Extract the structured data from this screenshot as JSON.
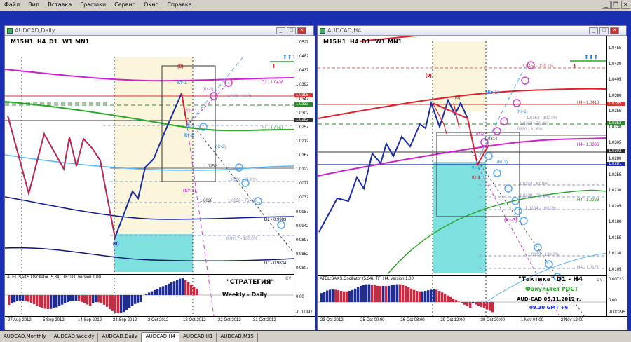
{
  "menu": [
    "Файл",
    "Вид",
    "Вставка",
    "Графики",
    "Сервис",
    "Окно",
    "Справка"
  ],
  "window_controls": [
    "_",
    "❐",
    "✕"
  ],
  "left_chart": {
    "title": "AUDCAD,Daily",
    "timeframes": [
      "M15",
      "H1",
      "H4",
      "D1",
      "W1",
      "MN1"
    ],
    "price_ticks": [
      "1.0527",
      "1.0482",
      "1.0437",
      "1.0392",
      "1.0347",
      "1.0302",
      "1.0257",
      "1.0212",
      "1.0167",
      "1.0122",
      "1.0077",
      "1.0032",
      "0.9987",
      "0.9942",
      "0.9897",
      "0.9852",
      "0.9807"
    ],
    "price_tags": [
      {
        "text": "1.0395",
        "color": "#d33"
      },
      {
        "text": "1.0333",
        "color": "#2a8a2a"
      },
      {
        "text": "1.0282",
        "color": "#333"
      }
    ],
    "date_ticks": [
      "27 Aug 2012",
      "5 Sep 2012",
      "14 Sep 2012",
      "24 Sep 2012",
      "3 Oct 2012",
      "12 Oct 2012",
      "22 Oct 2012",
      "31 Oct 2012"
    ],
    "oscillator_label": "ATEL:SAKS.Oscillator (5,34). TF: D1. version 1.00",
    "oscillator_ticks": [
      "0.00",
      "-0.01997"
    ],
    "oscillator_corner": "CV",
    "strategy_title": "\"СТРАТЕГИЯ\"",
    "strategy_sub": "Weekly - Daily",
    "wave_labels": {
      "zero_top": "(0)",
      "zero_bottom": "(0)",
      "k1": "Кт-1",
      "k2": "Кт-2",
      "k1b": "Кт-1",
      "ky2": "Ку-2",
      "kt1p": "(Кт-1)",
      "kg3": "(Кг-3)",
      "kt1m": "(Кт-1)"
    },
    "level_labels": [
      {
        "text": "D1 - 1.0438",
        "color": "#c000c0"
      },
      {
        "text": "0.986 - 0.0%",
        "color": "#88a"
      },
      {
        "text": "D1 - 1.0261",
        "color": "#2a8a2a"
      },
      {
        "text": "1.0152",
        "color": "#333"
      },
      {
        "text": "1.0096 - 61.8%",
        "color": "#88a"
      },
      {
        "text": "1.0028 - 76.4%",
        "color": "#88a"
      },
      {
        "text": "1.0028",
        "color": "#333"
      },
      {
        "text": "0.9917 - 100.0%",
        "color": "#88a"
      },
      {
        "text": "D1 - 0.9983",
        "color": "#003"
      },
      {
        "text": "D1 - 0.9834",
        "color": "#003"
      }
    ]
  },
  "right_chart": {
    "title": "AUDCAD,H4",
    "timeframes": [
      "M15",
      "H1",
      "H4",
      "D1",
      "W1",
      "MN1"
    ],
    "price_ticks": [
      "1.0455",
      "1.0430",
      "1.0405",
      "1.0380",
      "1.0355",
      "1.0330",
      "1.0305",
      "1.0280",
      "1.0255",
      "1.0230",
      "1.0205",
      "1.0180",
      "1.0155",
      "1.0130",
      "1.0105"
    ],
    "price_tags": [
      {
        "text": "1.0395",
        "color": "#d33"
      },
      {
        "text": "1.0353",
        "color": "#2a8a2a"
      },
      {
        "text": "1.0302",
        "color": "#333"
      },
      {
        "text": "1.0281",
        "color": "#1a2aa8"
      }
    ],
    "date_ticks": [
      "23 Oct 2012",
      "25 Oct 00:00",
      "26 Oct 08:00",
      "29 Oct 12:00",
      "30 Oct 20:00",
      "1 Nov 04:00",
      "2 Nov 12:00"
    ],
    "oscillator_label": "ATEL:SAKS.Oscillator (5,34). TF: H4. version 1.00",
    "oscillator_ticks": [
      "0.00723",
      "0.00",
      "-0.00295"
    ],
    "oscillator_corner": "DV",
    "tactic_title": "\"Тактика\"  D1 - H4",
    "faculty": "Факультет ГОСТ",
    "date_line": "AUD-CAD   05.11.2012  г.",
    "time_line": "09.30   GMT +6",
    "wave_labels": {
      "zero_red": "(0)",
      "zero_small": "(0)",
      "kt1": "(Кт-1)",
      "kt1c": "(Кт-1)",
      "kt2": "Кт-2",
      "kt1a": "Кт-1",
      "kt1b": "Кт-1",
      "kg3": "(Кг-3)",
      "kt3": "(Кт-3)"
    },
    "level_labels": [
      {
        "text": "1.0454 - 138.2%",
        "color": "#c66"
      },
      {
        "text": "H4 - 1.0418",
        "color": "#d33"
      },
      {
        "text": "1.0352 - 100.0%",
        "color": "#88a"
      },
      {
        "text": "1.0343 - 76.4%",
        "color": "#88a"
      },
      {
        "text": "1.0330 - 61.8%",
        "color": "#88a"
      },
      {
        "text": "1.0314",
        "color": "#333"
      },
      {
        "text": "H4 - 1.0306",
        "color": "#c000c0"
      },
      {
        "text": "1.0244 - 61.8%",
        "color": "#88a"
      },
      {
        "text": "1.0229 - 76.4%",
        "color": "#88a"
      },
      {
        "text": "H4 - 1.0223",
        "color": "#2a8a2a"
      },
      {
        "text": "1.0204 - 100.0%",
        "color": "#88a"
      },
      {
        "text": "1.0139 - 138.2%",
        "color": "#88a"
      },
      {
        "text": "H4 - 1.0121",
        "color": "#88a"
      }
    ]
  },
  "tabs": [
    "AUDCAD,Monthly",
    "AUDCAD,Weekly",
    "AUDCAD,Daily",
    "AUDCAD,H4",
    "AUDCAD,H1",
    "AUDCAD,M15"
  ],
  "active_tab": "AUDCAD,H4",
  "colors": {
    "mdi_background": "#1a2eb2",
    "bull_bar": "#1a2aa8",
    "bear_bar": "#e0203a",
    "fibo_line": "#8899cc",
    "highlight_cyan": "#7fe0e0",
    "highlight_cream": "#fbf5dc"
  }
}
